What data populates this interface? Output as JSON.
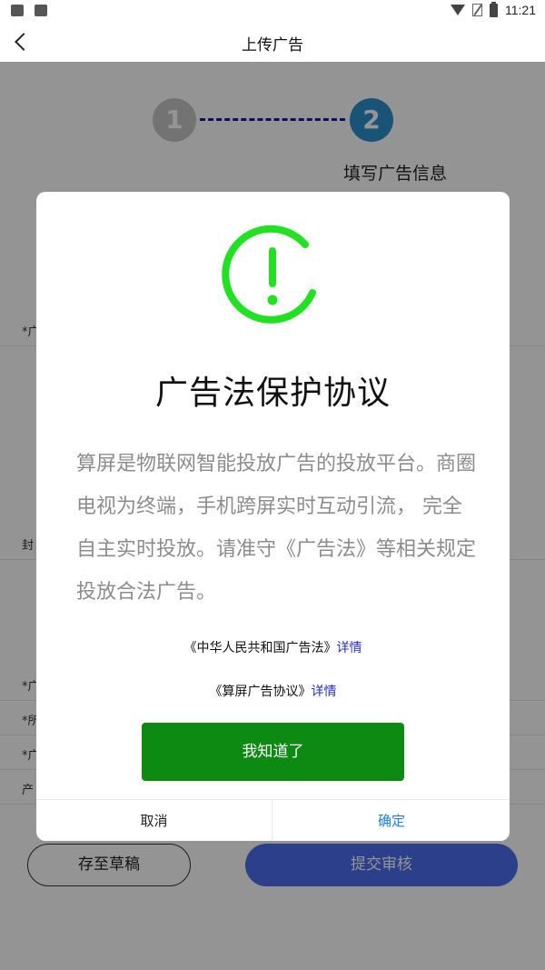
{
  "status_bar": {
    "time": "11:21"
  },
  "nav": {
    "title": "上传广告"
  },
  "stepper": {
    "steps": [
      {
        "number": "1",
        "state": "inactive"
      },
      {
        "number": "2",
        "state": "active"
      }
    ],
    "active_label": "填写广告信息"
  },
  "form": {
    "rows": [
      {
        "label": "*广",
        "required": true
      },
      {
        "label": "封",
        "required": false
      },
      {
        "label": "*广",
        "required": true
      },
      {
        "label": "*所",
        "required": true
      },
      {
        "label": "*广",
        "required": true
      },
      {
        "label": "产",
        "required": false
      }
    ]
  },
  "actions": {
    "draft_label": "存至草稿",
    "submit_label": "提交审核"
  },
  "dialog": {
    "title": "广告法保护协议",
    "body": "算屏是物联网智能投放广告的投放平台。商圈电视为终端，手机跨屏实时互动引流， 完全自主实时投放。请准守《广告法》等相关规定投放合法广告。",
    "links": [
      {
        "name": "《中华人民共和国广告法》",
        "detail": "详情"
      },
      {
        "name": "《算屏广告协议》",
        "detail": "详情"
      }
    ],
    "acknowledge_label": "我知道了",
    "cancel_label": "取消",
    "confirm_label": "确定"
  },
  "colors": {
    "accent_green": "#0c8a12",
    "icon_green": "#22e022",
    "link_blue": "#2430c6",
    "confirm_blue": "#1f7ee0",
    "step_active": "#2b8fcc",
    "submit_blue": "#4a6df0"
  },
  "icons": {
    "back": "chevron-left-icon",
    "alert": "exclamation-circle-icon"
  }
}
